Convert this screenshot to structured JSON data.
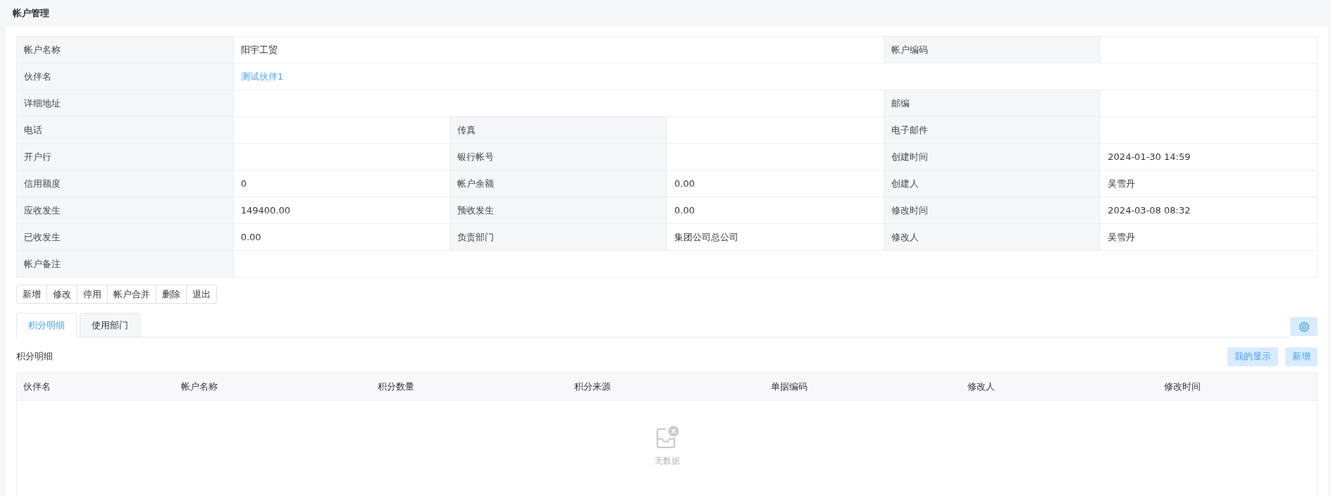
{
  "page_title": "帐户管理",
  "details": {
    "rows": [
      [
        {
          "label": "帐户名称",
          "value": "阳宇工贸"
        },
        {
          "label": "帐户编码"
        }
      ],
      [
        {
          "label": "伙伴名",
          "value": "测试伙伴1",
          "kind": "link"
        }
      ],
      [
        {
          "label": "详细地址"
        },
        {
          "label": "邮编"
        }
      ],
      [
        {
          "label": "电话"
        },
        {
          "label": "传真"
        },
        {
          "label": "电子邮件"
        }
      ],
      [
        {
          "label": "开户行"
        },
        {
          "label": "银行帐号"
        },
        {
          "label": "创建时间",
          "value": "2024-01-30 14:59"
        }
      ],
      [
        {
          "label": "信用额度",
          "value": "0"
        },
        {
          "label": "帐户余额",
          "value": "0.00"
        },
        {
          "label": "创建人",
          "value": "吴雪丹"
        }
      ],
      [
        {
          "label": "应收发生",
          "value": "149400.00"
        },
        {
          "label": "预收发生",
          "value": "0.00"
        },
        {
          "label": "修改时间",
          "value": "2024-03-08 08:32"
        }
      ],
      [
        {
          "label": "已收发生",
          "value": "0.00"
        },
        {
          "label": "负责部门",
          "value": "集团公司总公司"
        },
        {
          "label": "修改人",
          "value": "吴雪丹"
        }
      ],
      [
        {
          "label": "帐户备注"
        }
      ]
    ]
  },
  "actions": [
    "新增",
    "修改",
    "停用",
    "帐户合并",
    "删除",
    "退出"
  ],
  "tabs": [
    {
      "label": "积分明细",
      "selected": true
    },
    {
      "label": "使用部门",
      "selected": false
    }
  ],
  "section": {
    "title": "积分明细",
    "buttons": [
      "我的显示",
      "新增"
    ],
    "table": {
      "columns": [
        "伙伴名",
        "帐户名称",
        "积分数量",
        "积分来源",
        "单据编码",
        "修改人",
        "修改时间"
      ],
      "empty_text": "无数据"
    }
  }
}
